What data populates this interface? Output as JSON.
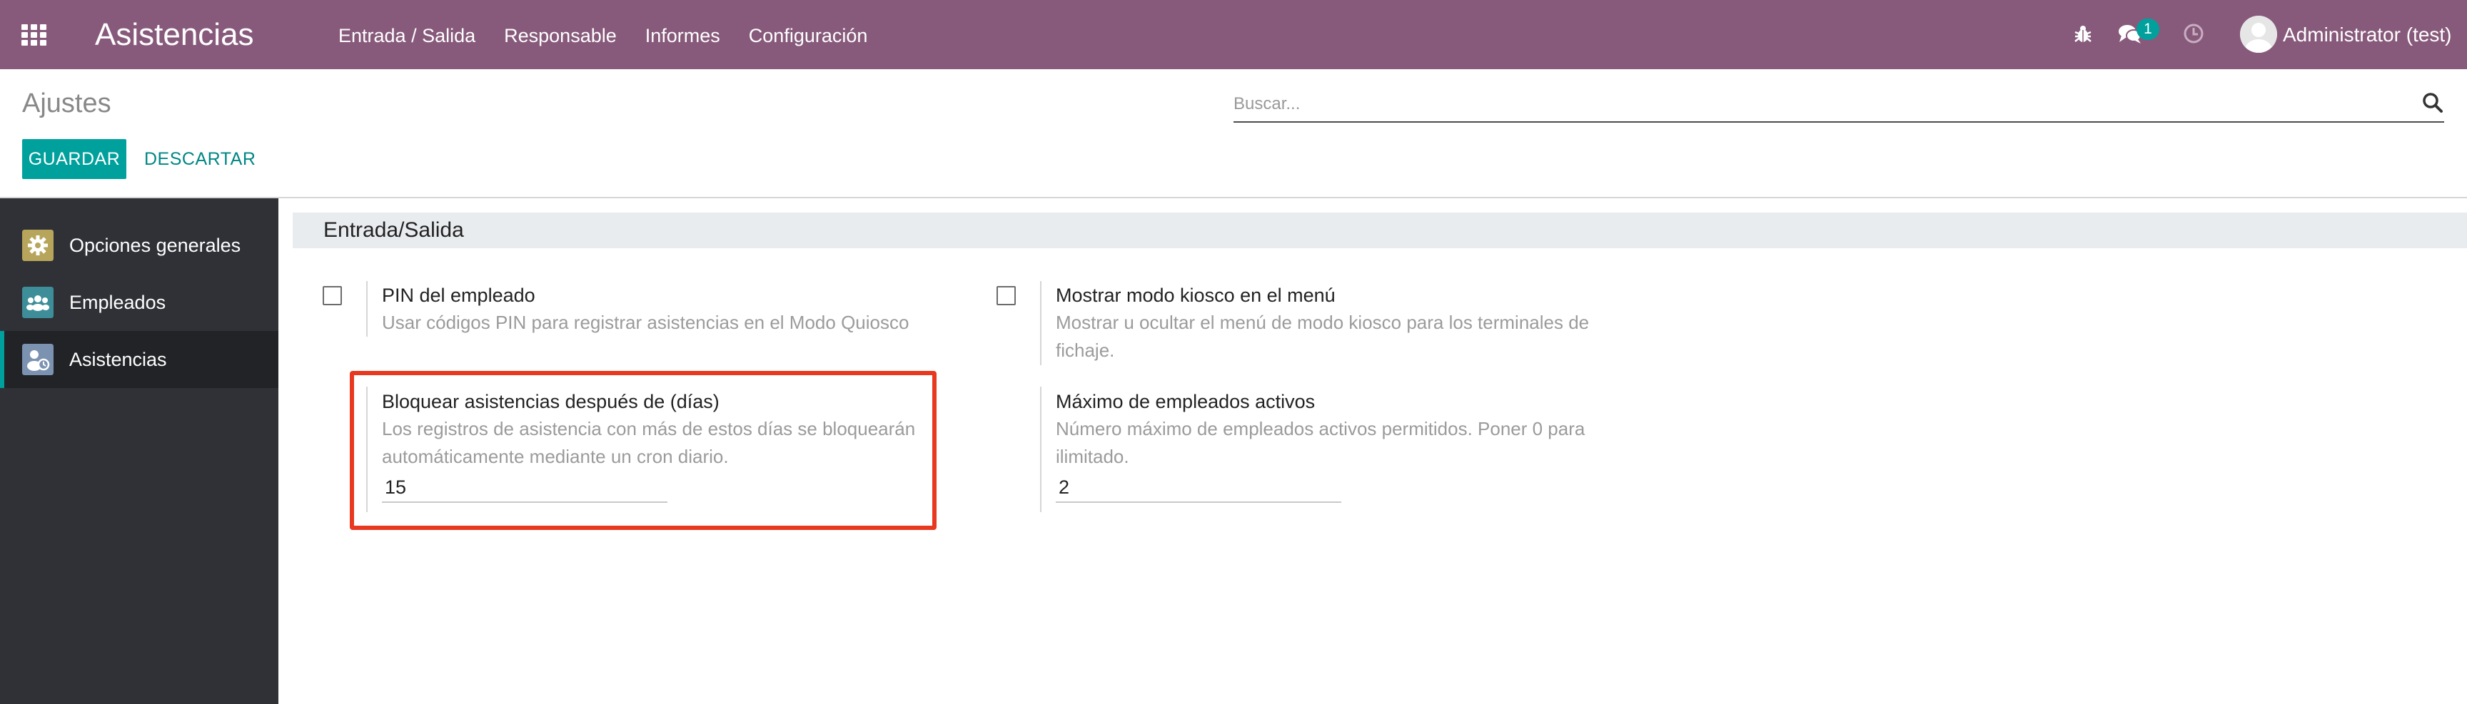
{
  "navbar": {
    "brand": "Asistencias",
    "menu": [
      "Entrada / Salida",
      "Responsable",
      "Informes",
      "Configuración"
    ],
    "messages_count": "1",
    "user": "Administrator (test)",
    "color": "#875a7b"
  },
  "control_panel": {
    "title": "Ajustes",
    "search_placeholder": "Buscar...",
    "save_label": "GUARDAR",
    "discard_label": "DESCARTAR"
  },
  "sidebar": {
    "items": [
      {
        "label": "Opciones generales",
        "icon": "gear-icon",
        "color": "#b7a55b"
      },
      {
        "label": "Empleados",
        "icon": "users-icon",
        "color": "#3e8e9a"
      },
      {
        "label": "Asistencias",
        "icon": "attendance-icon",
        "color": "#7c92b1"
      }
    ],
    "active_index": 2
  },
  "section": {
    "title": "Entrada/Salida",
    "settings": [
      {
        "title": "PIN del empleado",
        "description": "Usar códigos PIN para registrar asistencias en el Modo Quiosco",
        "checked": false
      },
      {
        "title": "Mostrar modo kiosco en el menú",
        "description": "Mostrar u ocultar el menú de modo kiosco para los terminales de fichaje.",
        "checked": false
      },
      {
        "title": "Bloquear asistencias después de (días)",
        "description": "Los registros de asistencia con más de estos días se bloquearán automáticamente mediante un cron diario.",
        "value": "15"
      },
      {
        "title": "Máximo de empleados activos",
        "description": "Número máximo de empleados activos permitidos. Poner 0 para ilimitado.",
        "value": "2"
      }
    ]
  },
  "colors": {
    "accent": "#00a09d",
    "sidebar_bg": "#2f3136",
    "highlight": "#e8381f"
  }
}
